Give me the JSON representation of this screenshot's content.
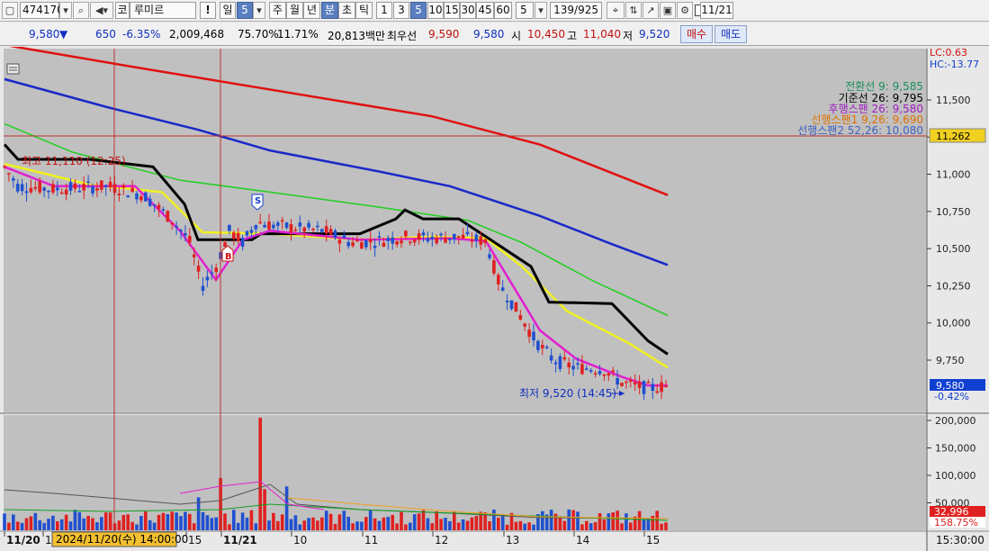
{
  "toolbar": {
    "code": "474170",
    "market": "코",
    "name": "루미르",
    "warn": "!",
    "period_buttons": [
      "일",
      "5"
    ],
    "units": [
      "주",
      "월",
      "년",
      "분",
      "초",
      "틱"
    ],
    "minutes": [
      "1",
      "3",
      "5",
      "10",
      "15",
      "30",
      "45",
      "60"
    ],
    "count": "5",
    "page": "139/925",
    "zero_label": "0",
    "date": "11/21"
  },
  "quote": {
    "price": "9,580",
    "arrow": "▼",
    "change": "650",
    "change_pct": "-6.35%",
    "volume": "2,009,468",
    "rate1": "75.70%",
    "rate2": "11.71%",
    "amount": "20,813백만",
    "best_label": "최우선",
    "ask": "9,590",
    "bid": "9,580",
    "open_label": "시",
    "open": "10,450",
    "high_label": "고",
    "high": "11,040",
    "low_label": "저",
    "low": "9,520",
    "buy": "매수",
    "sell": "매도"
  },
  "chart_labels": {
    "lc": "LC:0.63",
    "hc": "HC:-13.77",
    "legend": [
      "전환선 9: 9,585",
      "기준선 26: 9,795",
      "후행스팬 26: 9,580",
      "선행스팬1 9,26: 9,690",
      "선행스팬2 52,26: 10,080"
    ],
    "high_note": "최고 11,110 (12:25)",
    "low_note": "최저 9,520 (14:45)",
    "ref_price": "11,262",
    "last_price": "9,580",
    "last_pct": "-0.42%",
    "vol_last": "32,996",
    "vol_pct": "158.75%",
    "cursor_time": "2024/11/20(수) 14:00:00",
    "right_time": "15:30:00",
    "price_ticks": [
      "11,500",
      "11,250",
      "11,000",
      "10,750",
      "10,500",
      "10,250",
      "10,000",
      "9,750"
    ],
    "volume_ticks": [
      "200,000",
      "150,000",
      "100,000",
      "50,000"
    ],
    "time_ticks": [
      "11/20",
      "13",
      "15",
      "11/21",
      "10",
      "11",
      "12",
      "13",
      "14",
      "15"
    ]
  },
  "colors": {
    "up": "#e02020",
    "down": "#2050d0",
    "bg": "#c0c0c0"
  }
}
